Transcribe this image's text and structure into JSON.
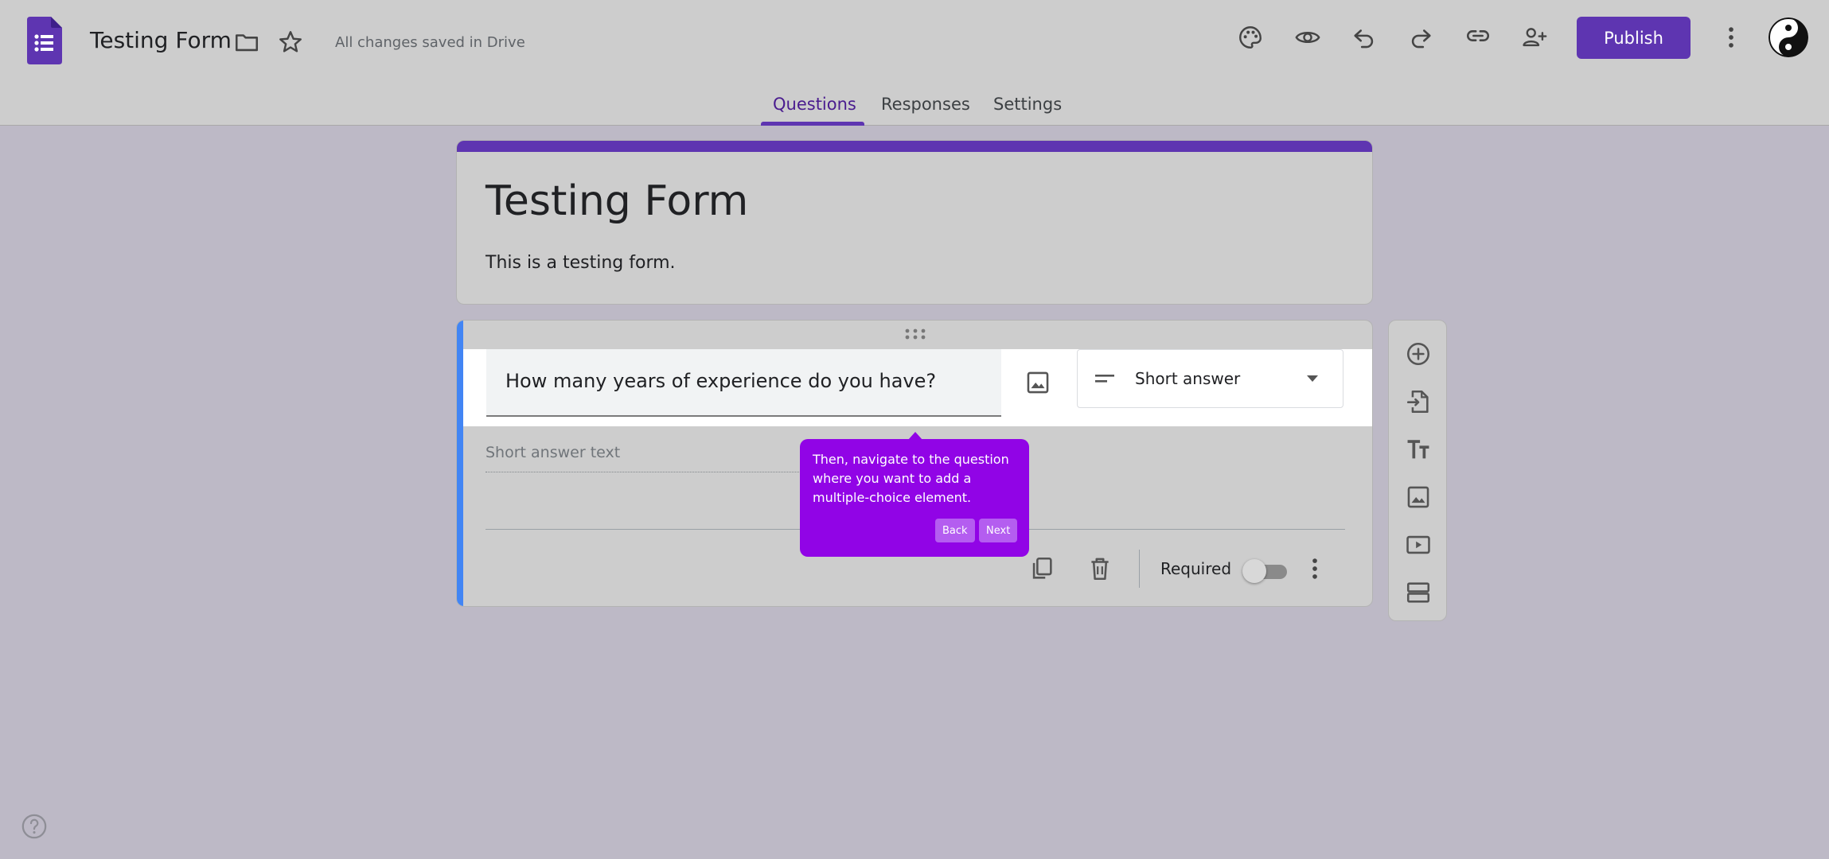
{
  "header": {
    "doc_title": "Testing Form",
    "save_status": "All changes saved in Drive",
    "publish_label": "Publish",
    "icons": [
      "forms-logo-icon",
      "folder-icon",
      "star-icon",
      "palette-icon",
      "eye-icon",
      "undo-icon",
      "redo-icon",
      "link-icon",
      "add-person-icon",
      "more-vert-icon"
    ]
  },
  "tabs": [
    {
      "label": "Questions",
      "active": true
    },
    {
      "label": "Responses",
      "active": false
    },
    {
      "label": "Settings",
      "active": false
    }
  ],
  "form": {
    "title": "Testing Form",
    "description": "This is a testing form."
  },
  "question": {
    "text": "How many years of experience do you have?",
    "type": "Short answer",
    "answer_placeholder": "Short answer text",
    "required_label": "Required",
    "required": false
  },
  "tooltip": {
    "text": "Then, navigate to the question where you want to add a multiple-choice element.",
    "back_label": "Back",
    "next_label": "Next"
  },
  "side_toolbar": [
    "add-question-icon",
    "import-questions-icon",
    "add-title-icon",
    "add-image-icon",
    "add-video-icon",
    "add-section-icon"
  ],
  "colors": {
    "accent": "#5e35b1",
    "tooltip": "#9104e6",
    "question_accent": "#4285f4"
  }
}
